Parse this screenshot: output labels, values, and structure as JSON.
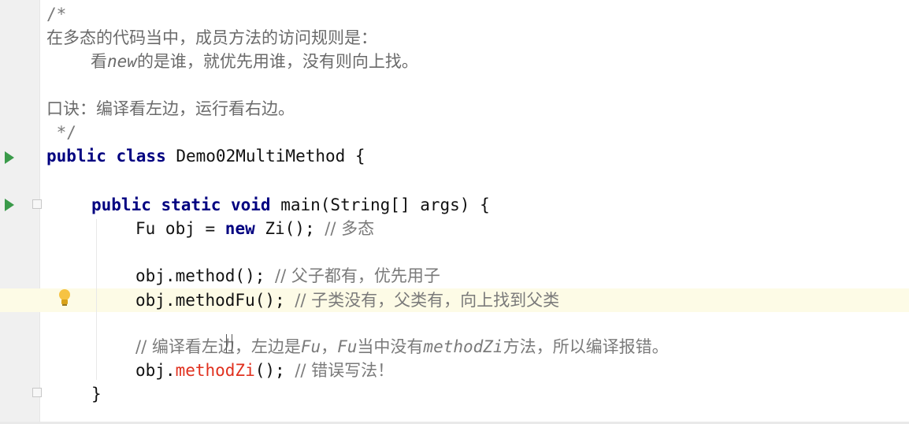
{
  "editor": {
    "lines": [
      {
        "text": "/*"
      },
      {
        "text": "在多态的代码当中，成员方法的访问规则是："
      },
      {
        "prefix": "看",
        "em": "new",
        "suffix": "的是谁，就优先用谁，没有则向上找。"
      },
      {
        "text": "口诀：编译看左边，运行看右边。"
      },
      {
        "text": " */"
      },
      {
        "kw": "public class",
        "rest": " Demo02MultiMethod {"
      },
      {
        "kw": "public static void",
        "rest": " main(String[] args) {"
      },
      {
        "code": "Fu obj = ",
        "kw": "new",
        "code2": " Zi(); ",
        "comment": "// 多态"
      },
      {
        "code": "obj.method(); ",
        "comment": "// 父子都有，优先用子"
      },
      {
        "code": "obj.methodFu(); ",
        "comment": "// 子类没有，父类有，向上找到父类"
      },
      {
        "comment_a": "// 编译看左边，左边是",
        "em1": "Fu",
        "comment_b": "，",
        "em2": "Fu",
        "comment_c": "当中没有",
        "em3": "methodZi",
        "comment_d": "方法，所以编译报错。"
      },
      {
        "code": "obj.",
        "error": "methodZi",
        "code2": "(); ",
        "comment": "// 错误写法！"
      },
      {
        "text": "}"
      }
    ]
  },
  "colors": {
    "keyword": "#000080",
    "comment": "#7a7a7a",
    "error": "#e0301e",
    "run_icon": "#3a9a4a",
    "current_line": "#fdfbe6"
  },
  "icons": {
    "run": "run-arrow-icon",
    "fold": "fold-icon",
    "intention": "lightbulb-icon"
  }
}
